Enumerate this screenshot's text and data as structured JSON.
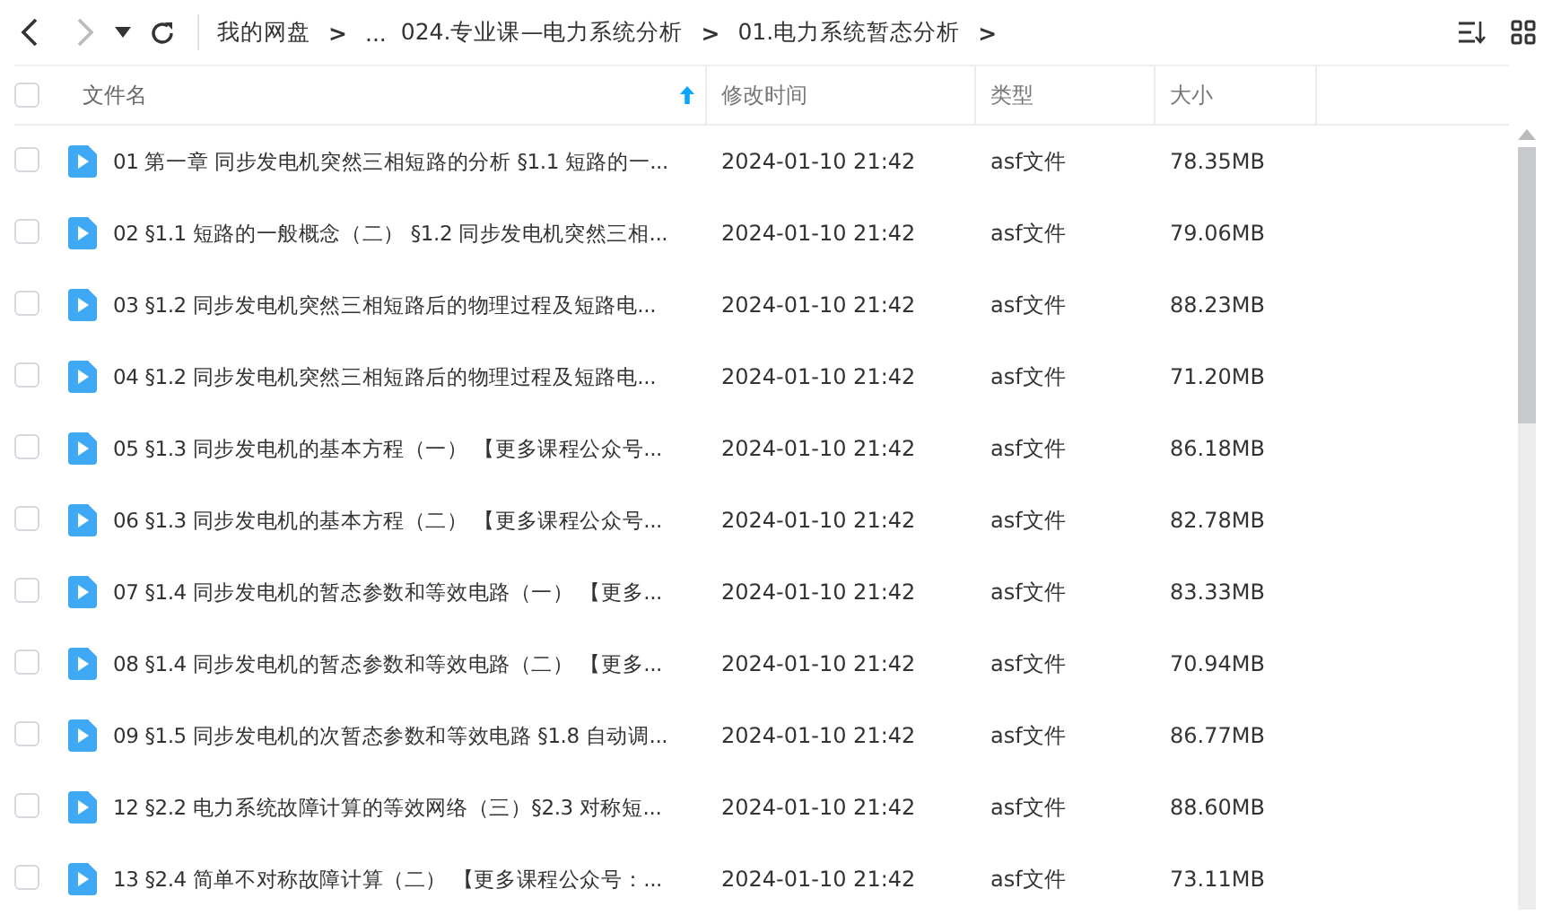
{
  "toolbar": {
    "back": {
      "disabled": false
    },
    "forward": {
      "disabled": true
    },
    "breadcrumbs": [
      {
        "label": "我的网盘",
        "separator": ">"
      },
      {
        "label": "..."
      },
      {
        "label": "024.专业课—电力系统分析",
        "separator": ">"
      },
      {
        "label": "01.电力系统暂态分析",
        "separator": ">"
      }
    ]
  },
  "header": {
    "checked": false,
    "columns": [
      {
        "label": "文件名",
        "sorted": true
      },
      {
        "label": "修改时间",
        "sorted": false
      },
      {
        "label": "类型",
        "sorted": false
      },
      {
        "label": "大小",
        "sorted": false
      }
    ]
  },
  "rows": [
    {
      "checked": false,
      "name": "01 第一章 同步发电机突然三相短路的分析 §1.1 短路的一...",
      "modified": "2024-01-10 21:42",
      "type": "asf文件",
      "size": "78.35MB"
    },
    {
      "checked": false,
      "name": "02 §1.1 短路的一般概念（二） §1.2 同步发电机突然三相...",
      "modified": "2024-01-10 21:42",
      "type": "asf文件",
      "size": "79.06MB"
    },
    {
      "checked": false,
      "name": "03 §1.2 同步发电机突然三相短路后的物理过程及短路电...",
      "modified": "2024-01-10 21:42",
      "type": "asf文件",
      "size": "88.23MB"
    },
    {
      "checked": false,
      "name": "04 §1.2 同步发电机突然三相短路后的物理过程及短路电...",
      "modified": "2024-01-10 21:42",
      "type": "asf文件",
      "size": "71.20MB"
    },
    {
      "checked": false,
      "name": "05 §1.3 同步发电机的基本方程（一）  【更多课程公众号...",
      "modified": "2024-01-10 21:42",
      "type": "asf文件",
      "size": "86.18MB"
    },
    {
      "checked": false,
      "name": "06 §1.3 同步发电机的基本方程（二）  【更多课程公众号...",
      "modified": "2024-01-10 21:42",
      "type": "asf文件",
      "size": "82.78MB"
    },
    {
      "checked": false,
      "name": "07 §1.4 同步发电机的暂态参数和等效电路（一）  【更多...",
      "modified": "2024-01-10 21:42",
      "type": "asf文件",
      "size": "83.33MB"
    },
    {
      "checked": false,
      "name": "08 §1.4 同步发电机的暂态参数和等效电路（二）  【更多...",
      "modified": "2024-01-10 21:42",
      "type": "asf文件",
      "size": "70.94MB"
    },
    {
      "checked": false,
      "name": "09 §1.5 同步发电机的次暂态参数和等效电路 §1.8 自动调...",
      "modified": "2024-01-10 21:42",
      "type": "asf文件",
      "size": "86.77MB"
    },
    {
      "checked": false,
      "name": "12 §2.2 电力系统故障计算的等效网络（三）§2.3 对称短...",
      "modified": "2024-01-10 21:42",
      "type": "asf文件",
      "size": "88.60MB"
    },
    {
      "checked": false,
      "name": "13 §2.4 简单不对称故障计算（二）  【更多课程公众号：...",
      "modified": "2024-01-10 21:42",
      "type": "asf文件",
      "size": "73.11MB"
    }
  ]
}
